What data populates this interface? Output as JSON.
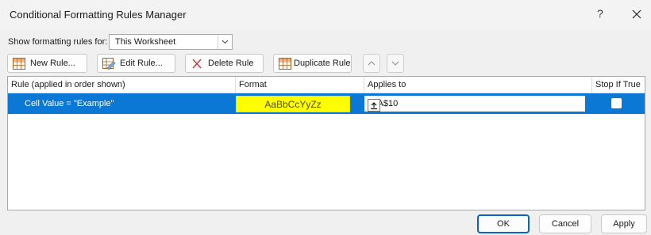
{
  "window": {
    "title": "Conditional Formatting Rules Manager",
    "help_glyph": "?",
    "close_icon": "close-icon"
  },
  "show_rules": {
    "label": "Show formatting rules for:",
    "selected": "This Worksheet"
  },
  "toolbar": {
    "new_rule": "New Rule...",
    "edit_rule": "Edit Rule...",
    "delete_rule": "Delete Rule",
    "duplicate_rule": "Duplicate Rule"
  },
  "table": {
    "headers": [
      "Rule (applied in order shown)",
      "Format",
      "Applies to",
      "Stop If True"
    ],
    "rows": [
      {
        "rule": "Cell Value = \"Example\"",
        "format_preview": "AaBbCcYyZz",
        "applies_to": "=$A$10",
        "stop_if_true": false
      }
    ]
  },
  "footer": {
    "ok": "OK",
    "cancel": "Cancel",
    "apply": "Apply"
  },
  "colors": {
    "selection": "#0a78d4",
    "format_fill": "#ffff00"
  }
}
